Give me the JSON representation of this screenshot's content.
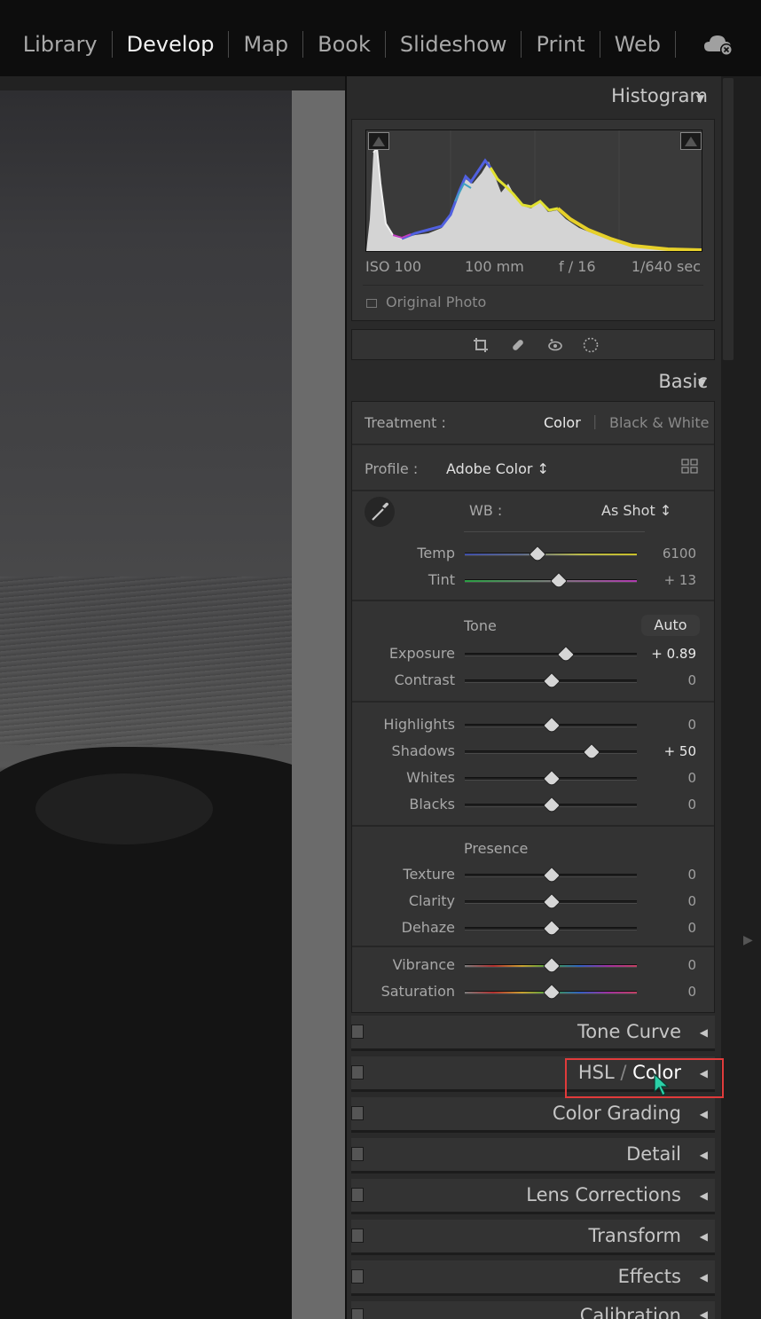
{
  "topbar": {
    "modules": [
      "Library",
      "Develop",
      "Map",
      "Book",
      "Slideshow",
      "Print",
      "Web"
    ],
    "active_module": "Develop",
    "cloud_icon": "cloud-sync-icon"
  },
  "histogram": {
    "title": "Histogram",
    "exif": {
      "iso": "ISO 100",
      "focal": "100 mm",
      "aperture": "f / 16",
      "shutter": "1/640 sec"
    },
    "original_photo": "Original Photo"
  },
  "tools": [
    "crop-icon",
    "healing-icon",
    "redeye-icon",
    "masking-icon"
  ],
  "basic": {
    "title": "Basic",
    "treatment_label": "Treatment :",
    "treatment_color": "Color",
    "treatment_bw": "Black & White",
    "profile_label": "Profile :",
    "profile_value": "Adobe Color ↕",
    "wb_label": "WB :",
    "wb_value": "As Shot ↕",
    "tone_label": "Tone",
    "auto_label": "Auto",
    "presence_label": "Presence",
    "sliders": {
      "temp": {
        "label": "Temp",
        "value": "6100",
        "pos": 0.42
      },
      "tint": {
        "label": "Tint",
        "value": "+ 13",
        "pos": 0.54
      },
      "exposure": {
        "label": "Exposure",
        "value": "+ 0.89",
        "pos": 0.58
      },
      "contrast": {
        "label": "Contrast",
        "value": "0",
        "pos": 0.5
      },
      "highlights": {
        "label": "Highlights",
        "value": "0",
        "pos": 0.5
      },
      "shadows": {
        "label": "Shadows",
        "value": "+ 50",
        "pos": 0.73
      },
      "whites": {
        "label": "Whites",
        "value": "0",
        "pos": 0.5
      },
      "blacks": {
        "label": "Blacks",
        "value": "0",
        "pos": 0.5
      },
      "texture": {
        "label": "Texture",
        "value": "0",
        "pos": 0.5
      },
      "clarity": {
        "label": "Clarity",
        "value": "0",
        "pos": 0.5
      },
      "dehaze": {
        "label": "Dehaze",
        "value": "0",
        "pos": 0.5
      },
      "vibrance": {
        "label": "Vibrance",
        "value": "0",
        "pos": 0.5
      },
      "saturation": {
        "label": "Saturation",
        "value": "0",
        "pos": 0.5
      }
    }
  },
  "collapsed_panels": {
    "tone_curve": "Tone Curve",
    "hsl_prefix": "HSL",
    "hsl_sep": "/",
    "hsl_color": "Color",
    "color_grading": "Color Grading",
    "detail": "Detail",
    "lens_corrections": "Lens Corrections",
    "transform": "Transform",
    "effects": "Effects",
    "calibration": "Calibration"
  }
}
